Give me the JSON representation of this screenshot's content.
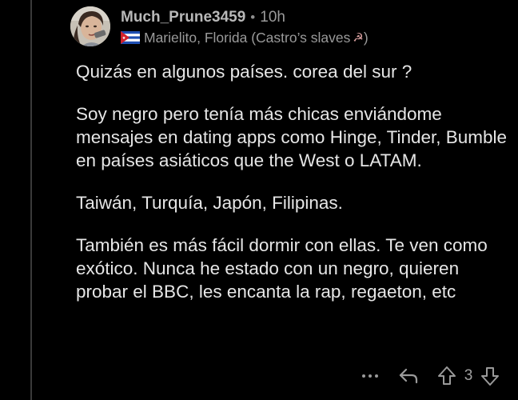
{
  "comment": {
    "username": "Much_Prune3459",
    "separator": "•",
    "timestamp": "10h",
    "flair": {
      "text": "Marielito, Florida (Castro’s slaves",
      "symbol": "☭",
      "close": ")"
    },
    "paragraphs": [
      "Quizás en algunos países.  corea del sur  ?",
      "Soy negro pero tenía más chicas enviándome mensajes en dating apps como Hinge, Tinder, Bumble en países asiáticos que the West o LATAM.",
      "Taiwán, Turquía, Japón, Filipinas.",
      "También es más fácil dormir con ellas. Te ven como exótico. Nunca he estado con un negro, quieren probar el BBC, les encanta la rap, regaeton, etc"
    ],
    "score": "3"
  },
  "icons": {
    "avatar": "user-avatar",
    "flag": "cuba-flag-icon",
    "more": "more-dots-icon",
    "reply": "reply-arrow-icon",
    "upvote": "upvote-arrow-icon",
    "downvote": "downvote-arrow-icon"
  },
  "colors": {
    "background": "#000000",
    "text": "#e6e6e6",
    "muted": "#9a9a9a",
    "thread_line": "#3a3a3a"
  }
}
